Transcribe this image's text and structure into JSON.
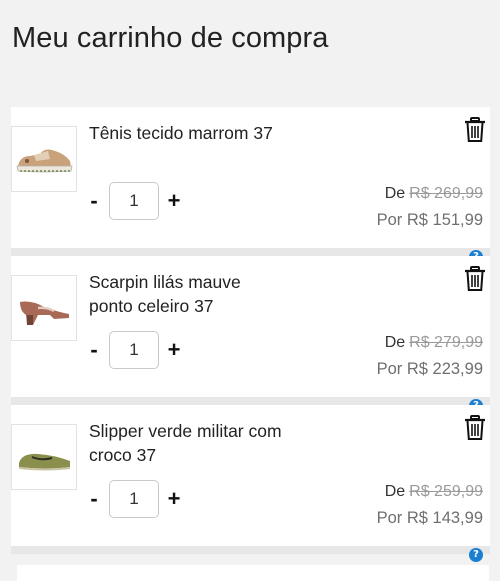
{
  "page": {
    "title": "Meu carrinho de compra"
  },
  "cart": {
    "items": [
      {
        "name": "Tênis tecido marrom 37",
        "quantity": "1",
        "decrement_label": "-",
        "increment_label": "+",
        "old_prefix": "De",
        "old_price": "R$ 269,99",
        "new_price": "Por R$ 151,99",
        "help_label": "?"
      },
      {
        "name": "Scarpin lilás mauve ponto celeiro 37",
        "quantity": "1",
        "decrement_label": "-",
        "increment_label": "+",
        "old_prefix": "De",
        "old_price": "R$ 279,99",
        "new_price": "Por R$ 223,99",
        "help_label": "?"
      },
      {
        "name": "Slipper verde militar com croco 37",
        "quantity": "1",
        "decrement_label": "-",
        "increment_label": "+",
        "old_prefix": "De",
        "old_price": "R$ 259,99",
        "new_price": "Por R$ 143,99",
        "help_label": "?"
      }
    ]
  },
  "icons": {
    "remove": "trash-icon",
    "help": "question-icon"
  },
  "colors": {
    "help_badge": "#1a7fd1",
    "old_price": "#9a9a9a",
    "new_price": "#6f6f6f",
    "background": "#f2f2f2"
  }
}
